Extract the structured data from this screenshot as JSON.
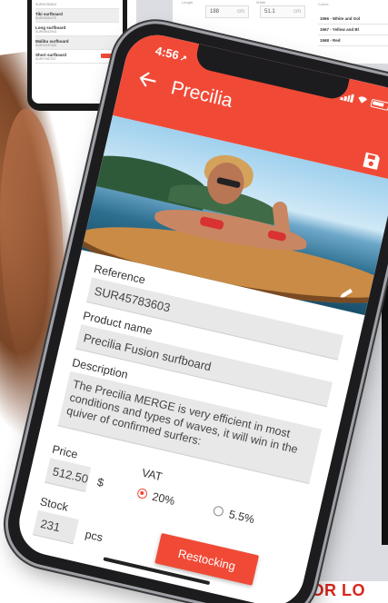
{
  "background": {
    "list_items": [
      {
        "title": "",
        "sub": "SUR45783603",
        "badge": "",
        "active": false
      },
      {
        "title": "Tiki surfboard",
        "sub": "SUR23950475",
        "badge": "",
        "active": true
      },
      {
        "title": "Long surfboard",
        "sub": "SUR09542903",
        "badge": "",
        "active": false
      },
      {
        "title": "Malibu surfboard",
        "sub": "SUR13137343",
        "badge": "",
        "active": true
      },
      {
        "title": "Short surfboard",
        "sub": "SUR07987327",
        "badge": "",
        "active": false
      }
    ],
    "fields": [
      {
        "label": "Length",
        "value": "188",
        "unit": "cm"
      },
      {
        "label": "Width",
        "value": "51.1",
        "unit": "cm"
      }
    ],
    "colors_label": "Colors",
    "colors": [
      "1566 - White and Gol",
      "1567 - Yellow and Bl",
      "1568 - Red"
    ],
    "footer_text": "POR LO"
  },
  "status": {
    "time": "4:56"
  },
  "header": {
    "title": "Precilia"
  },
  "form": {
    "reference_label": "Reference",
    "reference_value": "SUR45783603",
    "product_name_label": "Product name",
    "product_name_value": "Precilia Fusion surfboard",
    "description_label": "Description",
    "description_value": "The Precilia MERGE is very efficient in most conditions and types of waves, it will win in the quiver of confirmed surfers:",
    "price_label": "Price",
    "price_value": "512.50",
    "currency": "$",
    "vat_label": "VAT",
    "vat_options": [
      {
        "label": "20%",
        "checked": true
      },
      {
        "label": "5.5%",
        "checked": false
      }
    ],
    "stock_label": "Stock",
    "stock_value": "231",
    "stock_unit": "pcs",
    "restock_button": "Restocking"
  },
  "colors": {
    "accent": "#f04a37",
    "phone_frame": "#1c1c1e",
    "field_bg": "#e8e8e8"
  }
}
